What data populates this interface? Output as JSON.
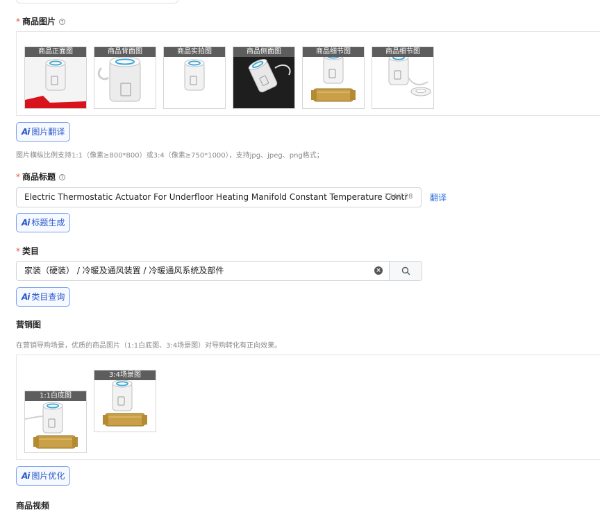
{
  "product_images": {
    "label": "商品图片",
    "required": "*",
    "help_icon": "question-circle-icon",
    "thumbs": [
      {
        "caption": "商品正面图",
        "style": "front-red"
      },
      {
        "caption": "商品背面图",
        "style": "back"
      },
      {
        "caption": "商品实拍图",
        "style": "real"
      },
      {
        "caption": "商品侧面图",
        "style": "side-dark"
      },
      {
        "caption": "商品细节图",
        "style": "valve"
      },
      {
        "caption": "商品细节图",
        "style": "ring"
      }
    ],
    "ai_button": "图片翻译",
    "hint": "图片横纵比例支持1:1（像素≥800*800）或3:4（像素≥750*1000），支持jpg、jpeg、png格式；"
  },
  "title_section": {
    "label": "商品标题",
    "required": "*",
    "value": "Electric Thermostatic Actuator For Underfloor Heating Manifold Constant Temperature Contr",
    "counter": "124/128",
    "translate_link": "翻译",
    "ai_button": "标题生成"
  },
  "category": {
    "label": "类目",
    "required": "*",
    "value": "家装（硬装） / 冷暖及通风装置 / 冷暖通风系统及部件",
    "ai_button": "类目查询"
  },
  "marketing": {
    "label": "营销图",
    "hint": "在营销导购场景，优质的商品图片（1:1白底图、3:4场景图）对导购转化有正向效果。",
    "images": [
      {
        "caption": "1:1白底图"
      },
      {
        "caption": "3:4场景图"
      }
    ],
    "ai_button": "图片优化"
  },
  "video": {
    "label": "商品视频"
  },
  "colors": {
    "required": "#e6553a",
    "link": "#2b6dd6",
    "ai_border": "#7a9ff0",
    "caption_bg": "#5d5d5d",
    "brass": "#c9a047",
    "actuator_white": "#f2f2f2",
    "actuator_ring": "#3aa7d8",
    "product_red": "#d8131b"
  }
}
